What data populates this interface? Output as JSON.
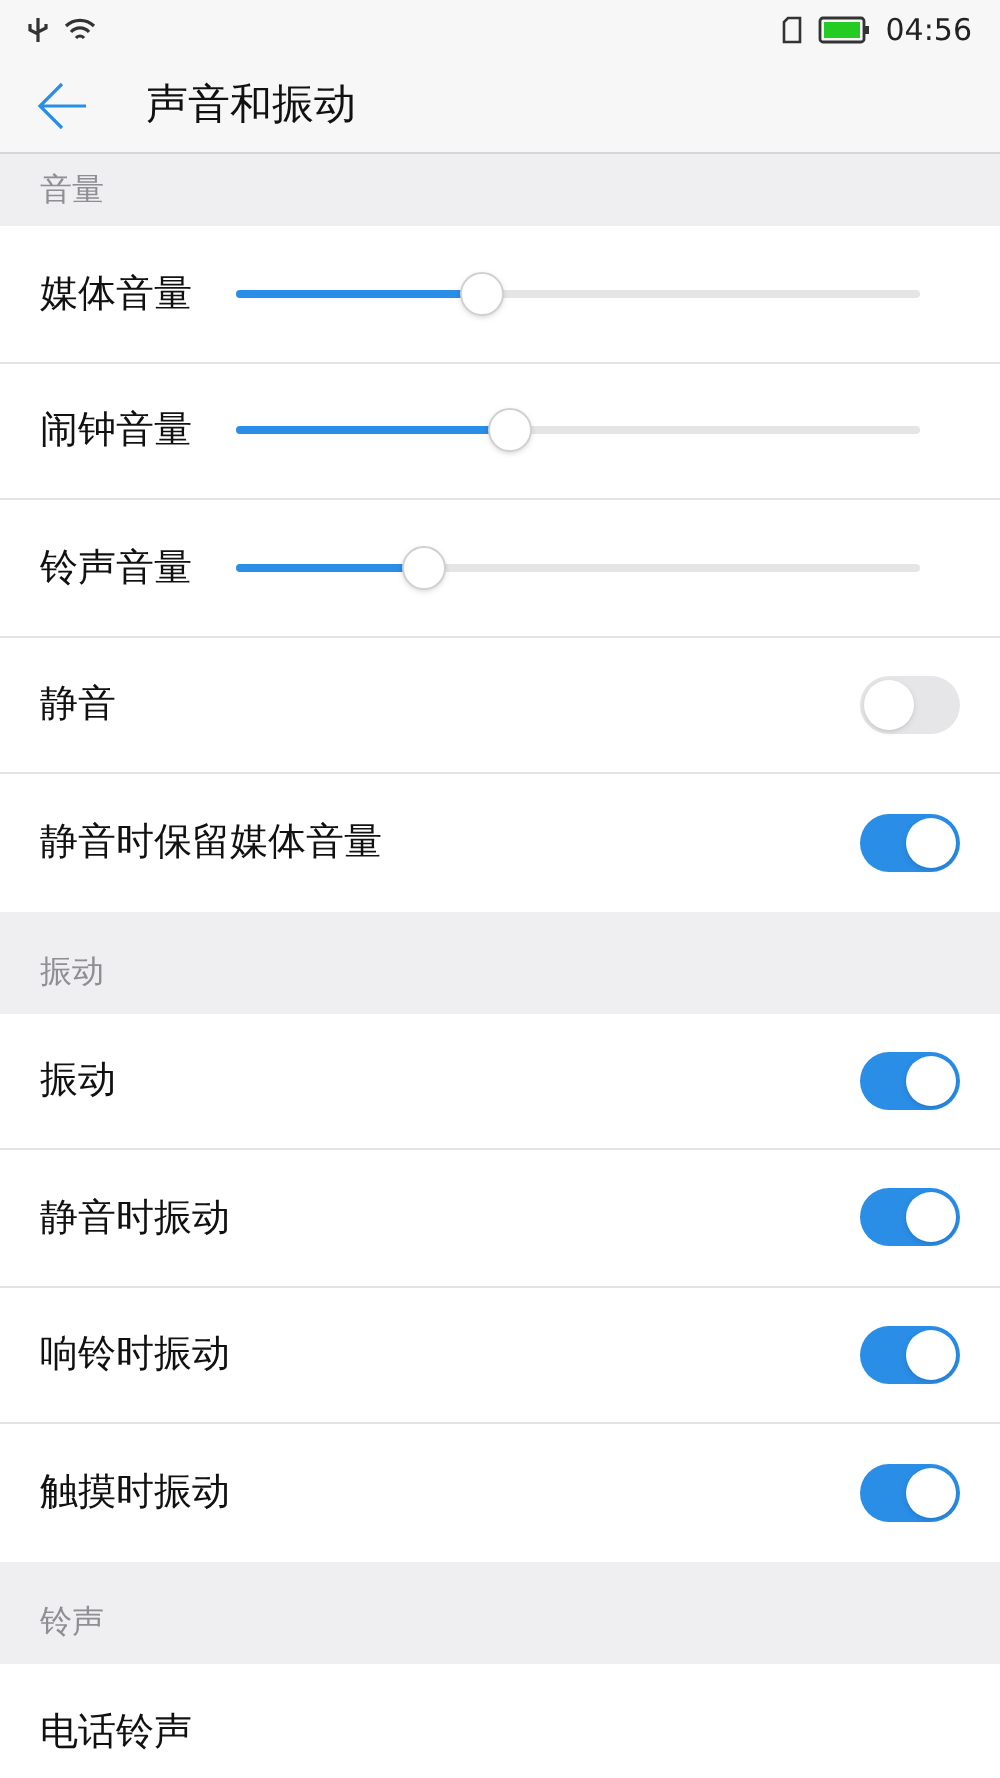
{
  "status_bar": {
    "time": "04:56"
  },
  "header": {
    "title": "声音和振动"
  },
  "sections": [
    {
      "title": "音量",
      "items": [
        {
          "kind": "slider",
          "label": "媒体音量",
          "level": 0.36
        },
        {
          "kind": "slider",
          "label": "闹钟音量",
          "level": 0.4
        },
        {
          "kind": "slider",
          "label": "铃声音量",
          "level": 0.275
        },
        {
          "kind": "toggle",
          "label": "静音",
          "on": false
        },
        {
          "kind": "toggle",
          "label": "静音时保留媒体音量",
          "on": true
        }
      ]
    },
    {
      "title": "振动",
      "items": [
        {
          "kind": "toggle",
          "label": "振动",
          "on": true
        },
        {
          "kind": "toggle",
          "label": "静音时振动",
          "on": true
        },
        {
          "kind": "toggle",
          "label": "响铃时振动",
          "on": true
        },
        {
          "kind": "toggle",
          "label": "触摸时振动",
          "on": true
        }
      ]
    },
    {
      "title": "铃声",
      "items": [
        {
          "kind": "link",
          "label": "电话铃声"
        }
      ]
    }
  ]
}
